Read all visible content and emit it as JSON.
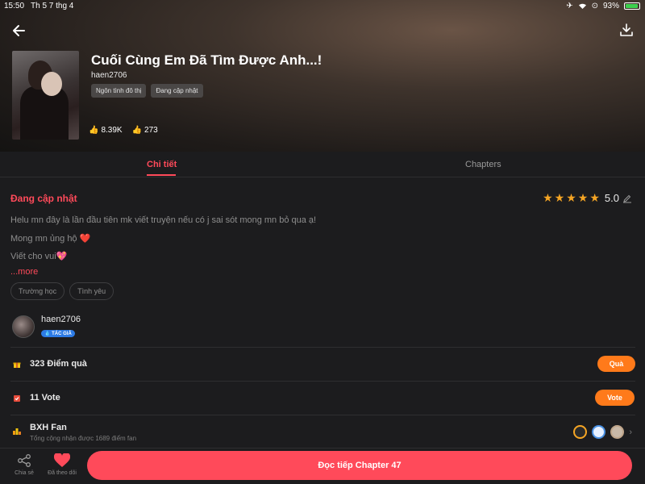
{
  "status_bar": {
    "time": "15:50",
    "date": "Th 5 7 thg 4",
    "battery": "93%"
  },
  "story": {
    "title": "Cuối Cùng Em Đã Tìm Được Anh...!",
    "author": "haen2706",
    "tags": [
      "Ngôn tình đô thị",
      "Đang cập nhật"
    ],
    "likes": "8.39K",
    "votes": "273"
  },
  "tabs": [
    {
      "label": "Chi tiết",
      "active": true
    },
    {
      "label": "Chapters",
      "active": false
    }
  ],
  "detail": {
    "status": "Đang cập nhật",
    "rating": "5.0",
    "rating_stars": 5,
    "description": [
      "Helu mn đây là lần đầu tiên mk viết truyện nếu có j sai sót mong mn bỏ qua ạ!",
      "Mong mn ủng hộ ❤️",
      "Viết cho vui💖"
    ],
    "more_label": "...more",
    "chips": [
      "Trường học",
      "Tình yêu"
    ]
  },
  "author_card": {
    "name": "haen2706",
    "badge": "TÁC GIẢ"
  },
  "gifts": {
    "label": "323 Điểm quà",
    "button": "Quà"
  },
  "vote": {
    "label": "11 Vote",
    "button": "Vote"
  },
  "fan": {
    "label": "BXH Fan",
    "subtitle": "Tổng cộng nhận được 1689 điểm fan"
  },
  "bottom_bar": {
    "share_label": "Chia sẻ",
    "follow_label": "Đã theo dõi",
    "read_button": "Đọc tiếp Chapter 47"
  },
  "colors": {
    "accent": "#ff4a5a",
    "gift_button": "#ff7a1a",
    "star": "#f5a524",
    "badge": "#2d7be5"
  }
}
